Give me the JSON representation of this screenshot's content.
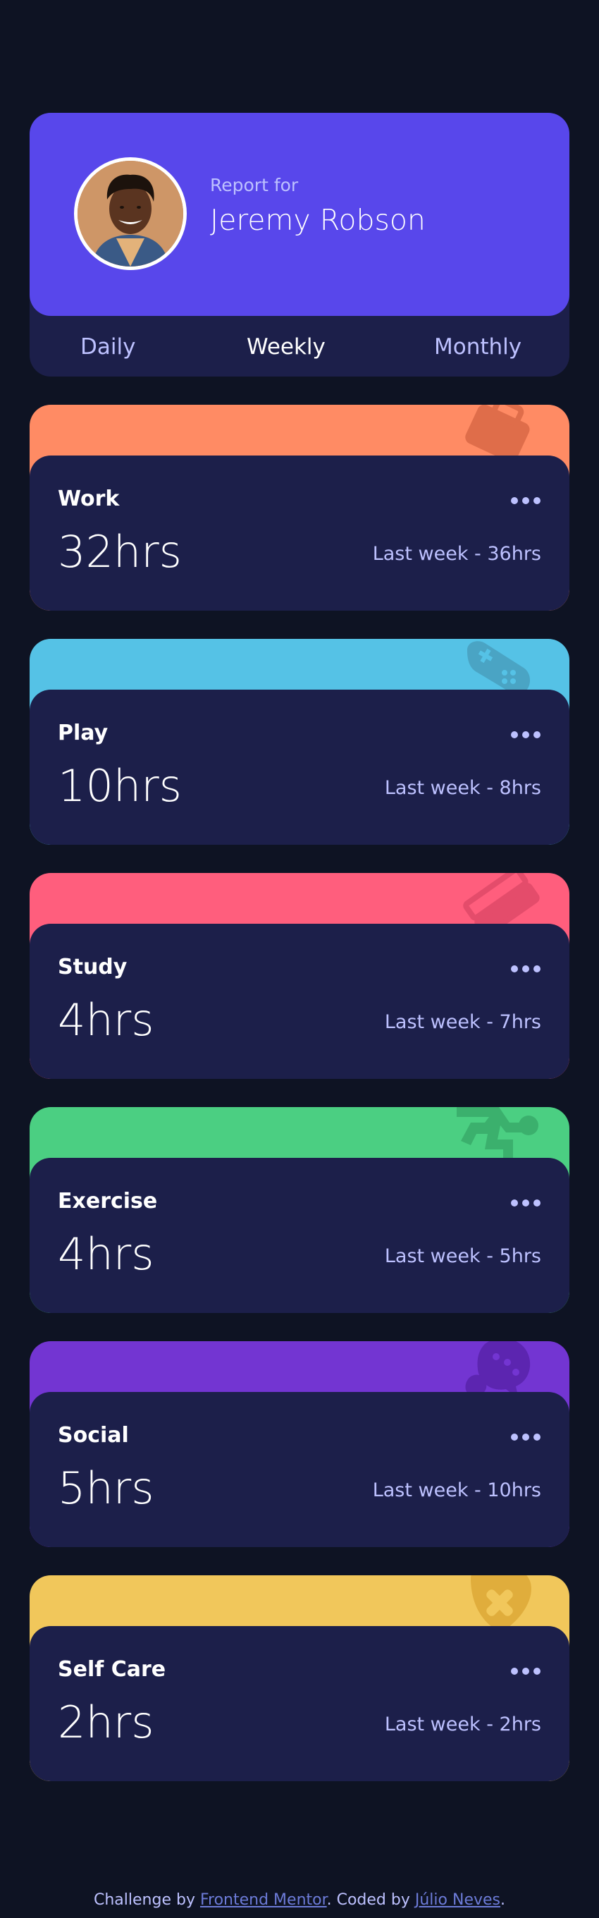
{
  "profile": {
    "report_for": "Report for",
    "name": "Jeremy Robson"
  },
  "tabs": [
    {
      "label": "Daily",
      "active": false
    },
    {
      "label": "Weekly",
      "active": true
    },
    {
      "label": "Monthly",
      "active": false
    }
  ],
  "cards": [
    {
      "title": "Work",
      "current": "32hrs",
      "previous": "Last week - 36hrs",
      "color": "#ff8b64",
      "icon": "work-icon"
    },
    {
      "title": "Play",
      "current": "10hrs",
      "previous": "Last week - 8hrs",
      "color": "#55c2e6",
      "icon": "play-icon"
    },
    {
      "title": "Study",
      "current": "4hrs",
      "previous": "Last week - 7hrs",
      "color": "#ff5e7d",
      "icon": "study-icon"
    },
    {
      "title": "Exercise",
      "current": "4hrs",
      "previous": "Last week - 5hrs",
      "color": "#4bcf82",
      "icon": "exercise-icon"
    },
    {
      "title": "Social",
      "current": "5hrs",
      "previous": "Last week - 10hrs",
      "color": "#7335d2",
      "icon": "social-icon"
    },
    {
      "title": "Self Care",
      "current": "2hrs",
      "previous": "Last week - 2hrs",
      "color": "#f1c75b",
      "icon": "self-care-icon"
    }
  ],
  "footer": {
    "prefix": "Challenge by ",
    "link1": "Frontend Mentor",
    "middle": ". Coded by ",
    "link2": "Júlio Neves",
    "suffix": "."
  },
  "colors": {
    "background": "#0e1323",
    "card": "#1c1f4a",
    "profile": "#5847eb",
    "muted_text": "#bdc1ff"
  }
}
